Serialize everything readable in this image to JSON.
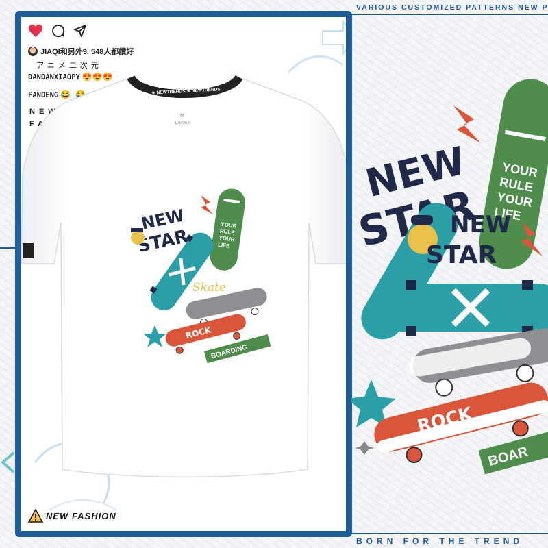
{
  "banners": {
    "top": "VARIOUS CUSTOMIZED PATTERNS NEW PROD",
    "bottom": "BORN FOR THE TREND"
  },
  "post": {
    "actions": [
      "heart-icon",
      "comment-icon",
      "share-icon"
    ],
    "likes_text": "JIAQI和另外9, 548人都讚好",
    "kana": "アニメ二次元",
    "comments": [
      {
        "user": "DANDANXIAOPY",
        "emoji": "😍😍😍"
      },
      {
        "user": "FANDENG",
        "emoji": "😂 😂"
      }
    ],
    "side_lines": [
      "NEW",
      "FASH"
    ],
    "footer_brand": "NEW FASHION"
  },
  "shirt": {
    "collar_text": "★ NEWTRENDS ★ NEWTRENDS",
    "tag_size": "M",
    "tag_spec": "170/96A",
    "print": {
      "headline_1": "NEW",
      "headline_2": "STAR",
      "board_text": [
        "YOUR",
        "RULE",
        "YOUR",
        "LIFE"
      ],
      "script": "Skate",
      "rock": "ROCK",
      "ribbon": "BOARDING"
    }
  },
  "right_art": {
    "headline_1": "NEW",
    "headline_2": "STAR",
    "overlay_1": "NEW",
    "overlay_2": "STAR",
    "board_text": [
      "YOUR",
      "RULE",
      "YOUR",
      "LIFE"
    ],
    "rock": "ROCK",
    "ribbon": "BOAR"
  },
  "colors": {
    "brand_blue": "#1e5b99",
    "teal": "#2a9fa8",
    "green": "#4e8d4c",
    "navy": "#1f2a4a",
    "orange": "#d9563a",
    "heart": "#e8304a"
  }
}
